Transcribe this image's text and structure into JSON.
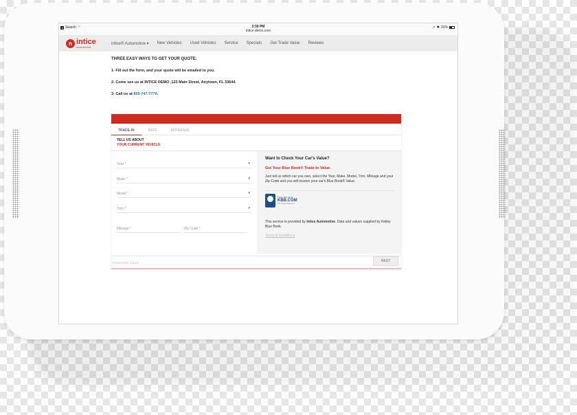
{
  "status_bar": {
    "back_label": "Search",
    "time": "3:39 PM",
    "url": "intice demo.com",
    "battery": "31%"
  },
  "nav": {
    "logo_main": "intice",
    "logo_sub": "automotive",
    "items": [
      "intice® Automotive ▾",
      "New Vehicles",
      "Used Vehicles",
      "Service",
      "Specials",
      "Get Trade Value",
      "Reviews"
    ]
  },
  "content": {
    "title": "THREE EASY WAYS TO GET YOUR QUOTE:",
    "step1": "1- Fill out the form, and your quote will be emailed to you.",
    "step2": "2- Come see us at INTICE DEMO ,123 Main Street, Anytown, FL 33644.",
    "step3_prefix": "3- Call us at ",
    "phone": "855-747-7770",
    "step3_suffix": "."
  },
  "form": {
    "tabs": [
      "TRADE-IN",
      "RATE",
      "APPRAISAL"
    ],
    "tell_line1": "TELL US ABOUT",
    "tell_line2": "YOUR CURRENT VEHICLE",
    "fields": {
      "year": "Year *",
      "make": "Make *",
      "model": "Model *",
      "trim": "Trim *",
      "mileage": "Mileage *",
      "zip": "Zip Code *"
    },
    "powered_by": "Powered by intice®",
    "next_label": "NEXT"
  },
  "kbb": {
    "title": "Want to Check Your Car's Value?",
    "subtitle": "Get Your Blue Book® Trade-In Value.",
    "description": "Just tell us which car you own, select the Year, Make, Model, Trim, Mileage and your Zip Code and you will receive your car's Blue Book® Value.",
    "logo_small": "Kelley Blue Book",
    "logo_big": "KBB.COM",
    "logo_tag": "The Trusted Resource",
    "provided_prefix": "This service is provided by ",
    "provided_strong": "Intice Automotive",
    "provided_suffix": ". Data and values supplied by Kelley Blue Book.",
    "terms": "Terms & Conditions"
  }
}
